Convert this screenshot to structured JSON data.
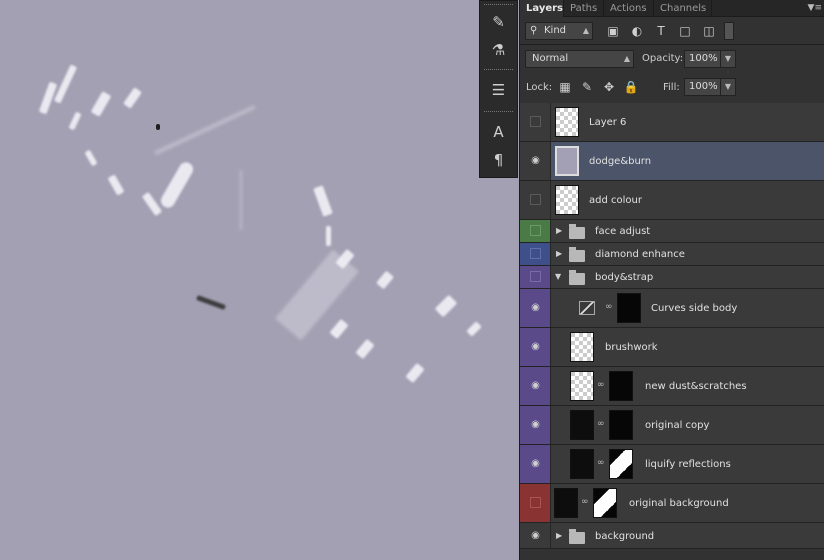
{
  "tabs": [
    {
      "label": "Layers",
      "active": true
    },
    {
      "label": "Paths",
      "active": false
    },
    {
      "label": "Actions",
      "active": false
    },
    {
      "label": "Channels",
      "active": false
    }
  ],
  "filter": {
    "kind_label": "Kind"
  },
  "blend": {
    "mode": "Normal",
    "opacity_label": "Opacity:",
    "opacity_value": "100%"
  },
  "lock": {
    "label": "Lock:",
    "fill_label": "Fill:",
    "fill_value": "100%"
  },
  "colors": {
    "green": "#4a7a45",
    "blue": "#3f4f8a",
    "purple": "#5a4a8a",
    "red": "#8a3333",
    "selected": "#4b5468"
  },
  "layers": [
    {
      "name": "Layer 6",
      "visible": false
    },
    {
      "name": "dodge&burn",
      "visible": true
    },
    {
      "name": "add colour",
      "visible": false
    },
    {
      "name": "face adjust",
      "visible": false
    },
    {
      "name": "diamond enhance",
      "visible": false
    },
    {
      "name": "body&strap",
      "visible": false
    },
    {
      "name": "Curves side body",
      "visible": true
    },
    {
      "name": "brushwork",
      "visible": true
    },
    {
      "name": "new dust&scratches",
      "visible": true
    },
    {
      "name": "original copy",
      "visible": true
    },
    {
      "name": "liquify reflections",
      "visible": true
    },
    {
      "name": "original background",
      "visible": false
    },
    {
      "name": "background",
      "visible": true
    }
  ]
}
